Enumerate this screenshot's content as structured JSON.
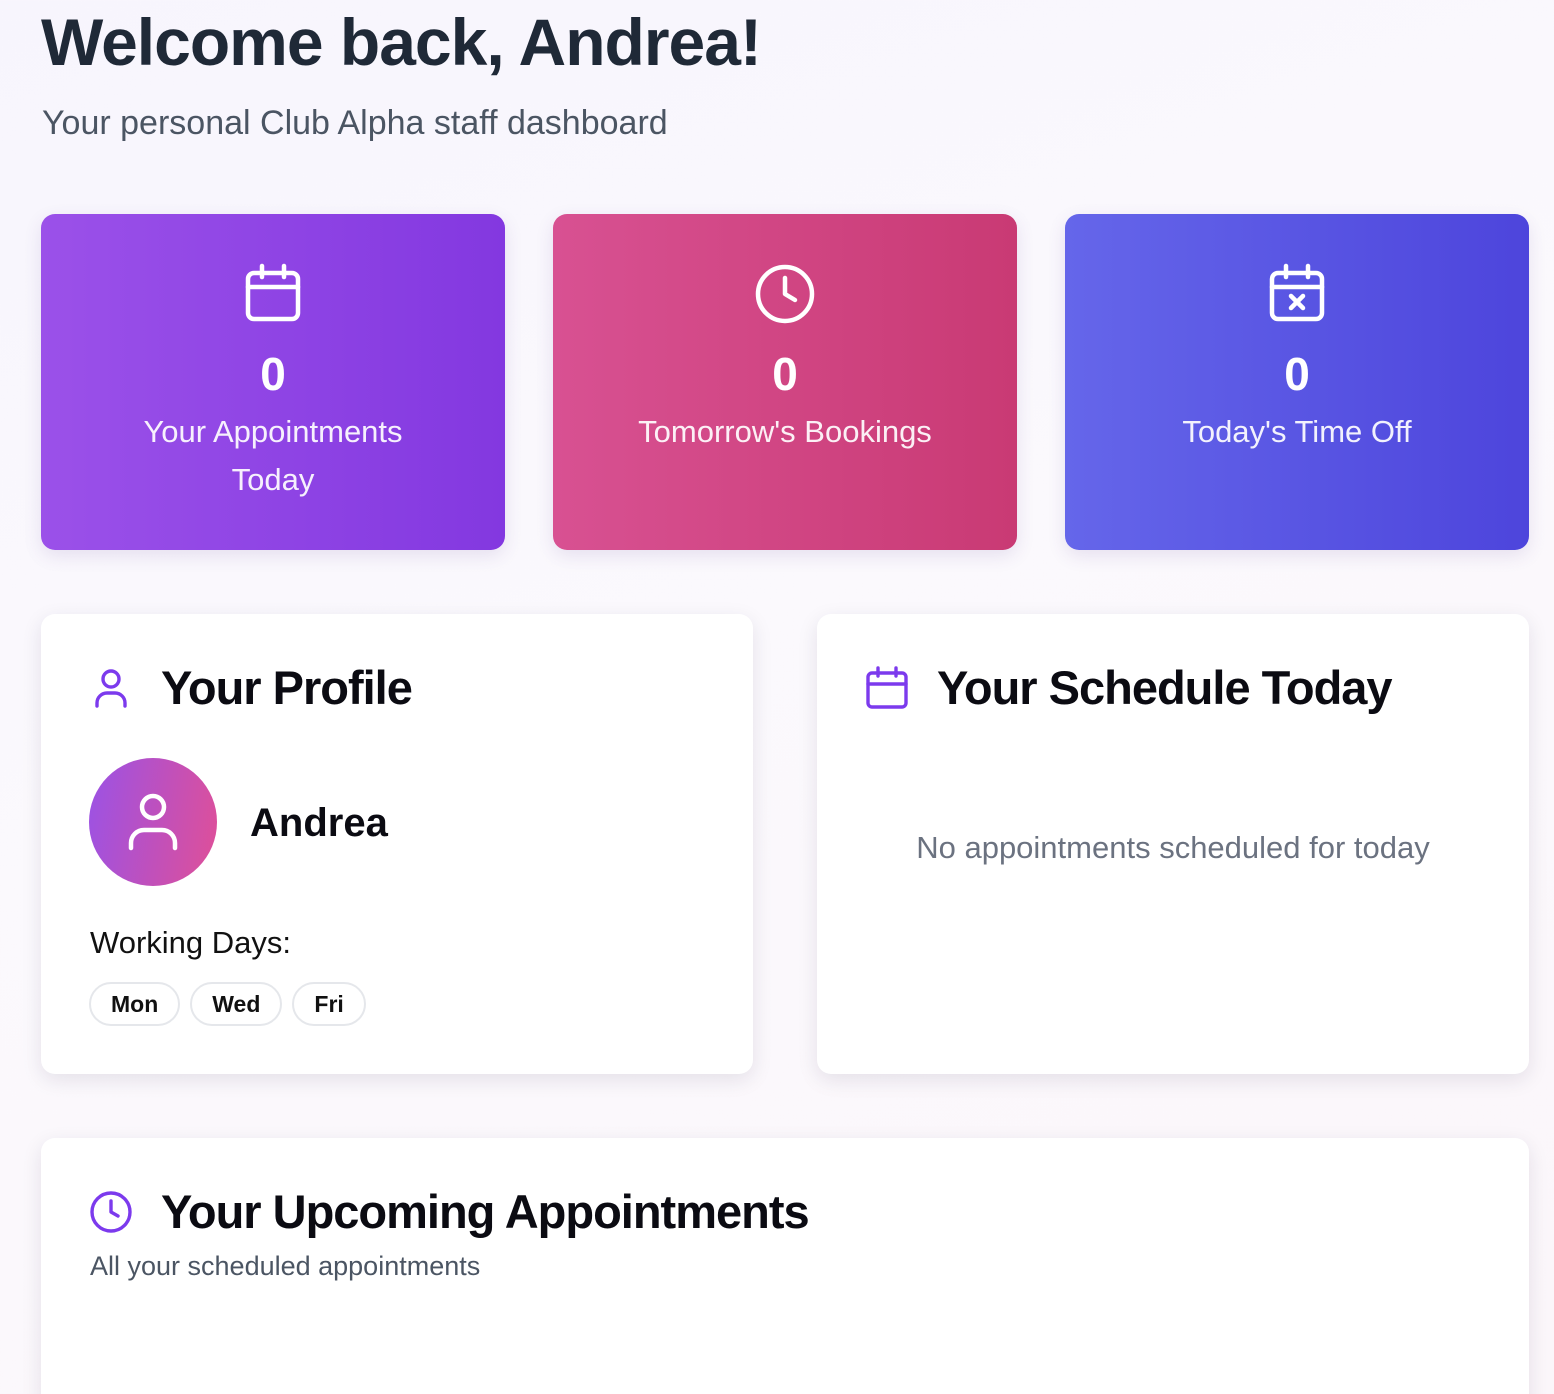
{
  "header": {
    "title": "Welcome back, Andrea!",
    "subtitle": "Your personal Club Alpha staff dashboard"
  },
  "stats": [
    {
      "icon": "calendar-icon",
      "value": "0",
      "label": "Your Appointments Today",
      "color_from": "#9b51e9",
      "color_to": "#8338e0"
    },
    {
      "icon": "clock-icon",
      "value": "0",
      "label": "Tomorrow's Bookings",
      "color_from": "#d85192",
      "color_to": "#c93a74"
    },
    {
      "icon": "calendar-x-icon",
      "value": "0",
      "label": "Today's Time Off",
      "color_from": "#6566ea",
      "color_to": "#4d45dc"
    }
  ],
  "profile": {
    "title": "Your Profile",
    "icon": "user-icon",
    "name": "Andrea",
    "working_days_label": "Working Days:",
    "working_days": [
      "Mon",
      "Wed",
      "Fri"
    ]
  },
  "schedule": {
    "title": "Your Schedule Today",
    "icon": "calendar-icon",
    "empty_message": "No appointments scheduled for today"
  },
  "upcoming": {
    "title": "Your Upcoming Appointments",
    "icon": "clock-icon",
    "subtitle": "All your scheduled appointments"
  },
  "colors": {
    "accent": "#7c3aed",
    "title_text": "#1f2937",
    "muted_text": "#6b7280"
  }
}
